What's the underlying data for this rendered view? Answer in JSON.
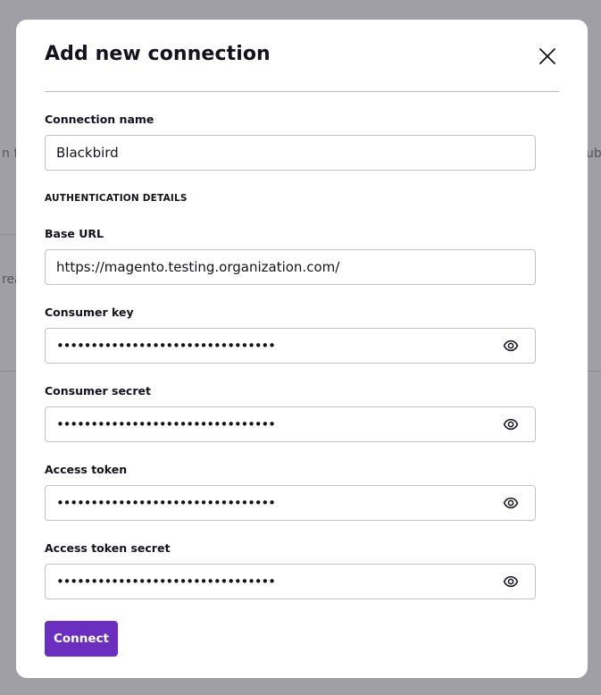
{
  "background": {
    "fragments": [
      "n fo",
      "ub",
      "rea"
    ]
  },
  "modal": {
    "title": "Add new connection"
  },
  "connection_name": {
    "label": "Connection name",
    "value": "Blackbird"
  },
  "auth_section": {
    "label": "AUTHENTICATION DETAILS"
  },
  "base_url": {
    "label": "Base URL",
    "value": "https://magento.testing.organization.com/"
  },
  "consumer_key": {
    "label": "Consumer key",
    "value": "••••••••••••••••••••••••••••••••"
  },
  "consumer_secret": {
    "label": "Consumer secret",
    "value": "••••••••••••••••••••••••••••••••"
  },
  "access_token": {
    "label": "Access token",
    "value": "••••••••••••••••••••••••••••••••"
  },
  "access_token_secret": {
    "label": "Access token secret",
    "value": "••••••••••••••••••••••••••••••••"
  },
  "actions": {
    "connect_label": "Connect"
  },
  "colors": {
    "accent": "#6b2fc0",
    "backdrop": "#a09fa6",
    "text": "#15111f",
    "border": "#c2c1c8"
  },
  "icons": {
    "close": "close-icon",
    "reveal": "eye-icon"
  }
}
